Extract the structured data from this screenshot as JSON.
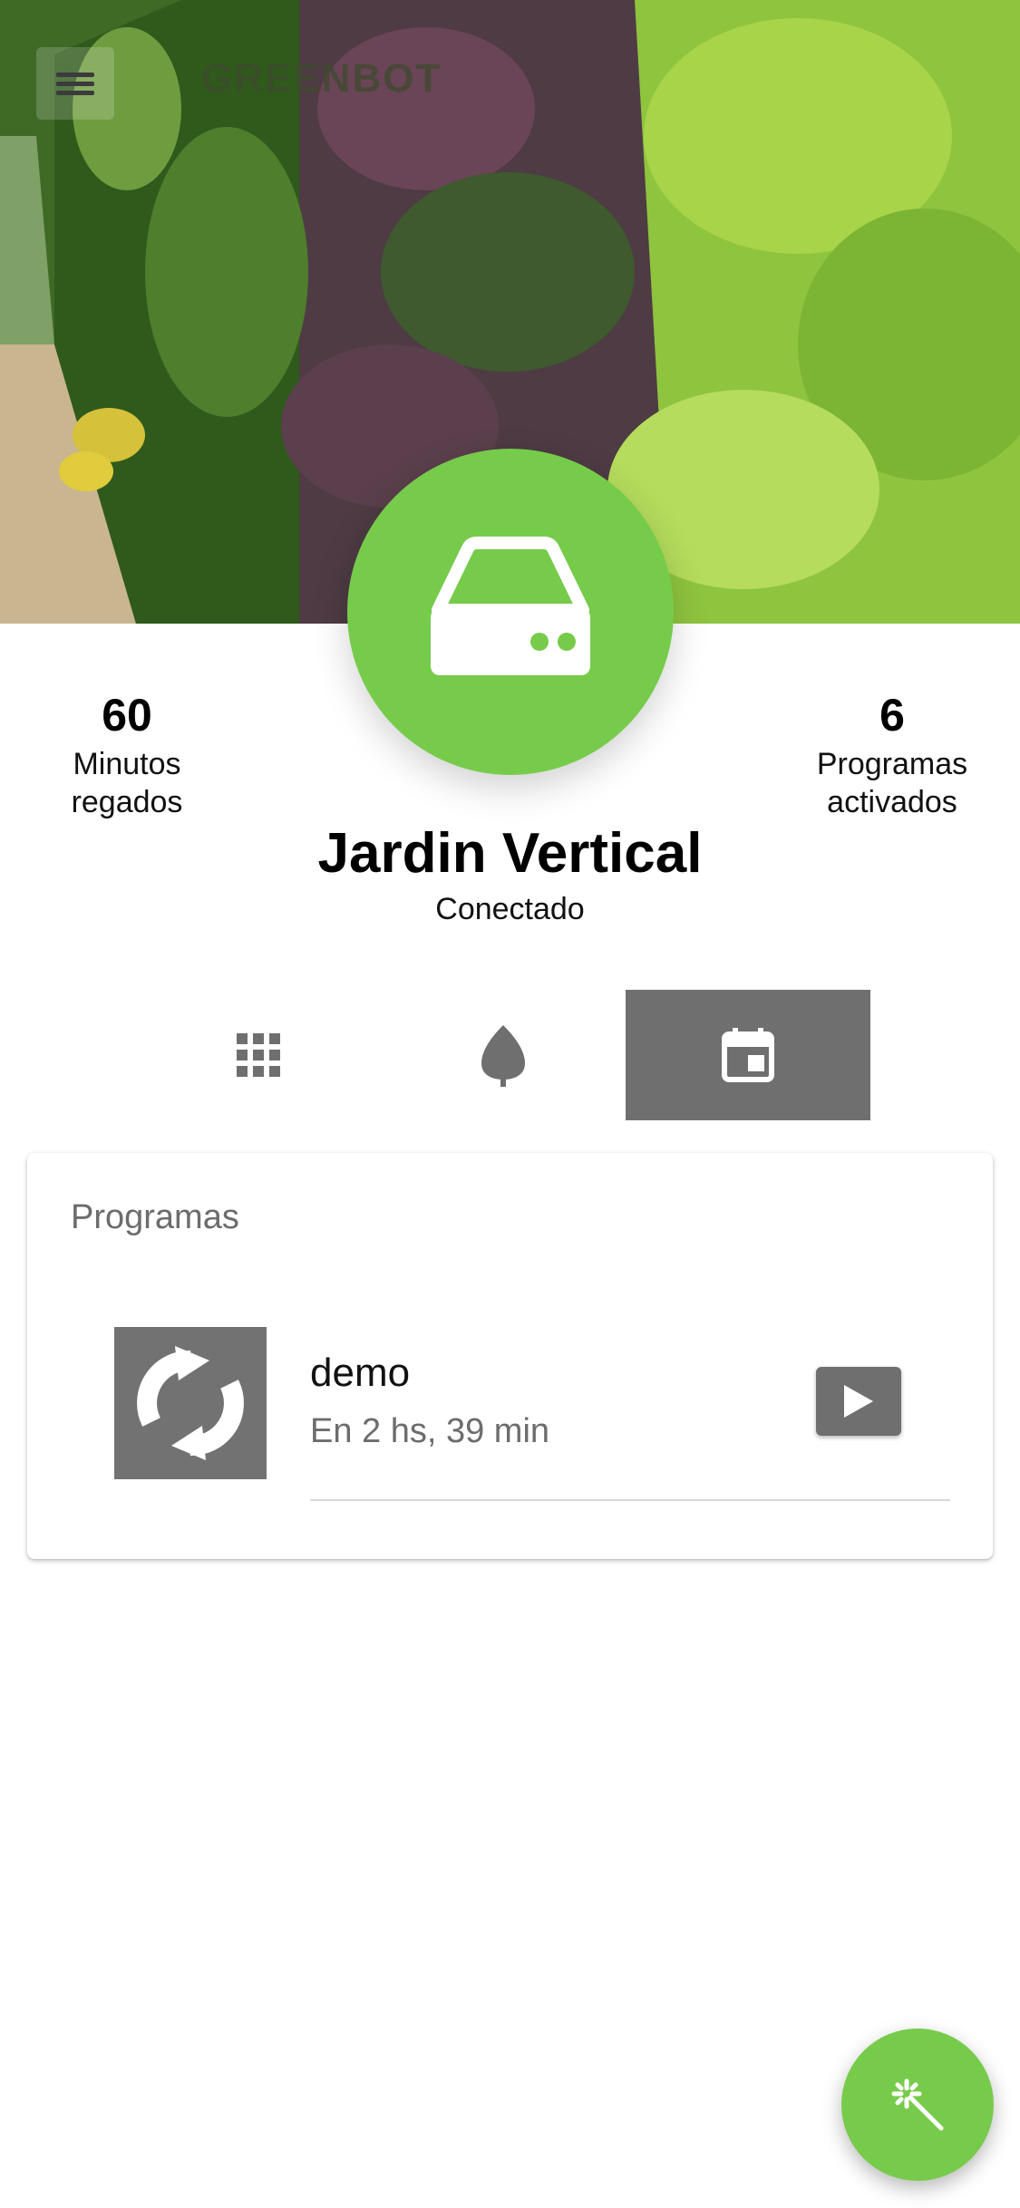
{
  "app": {
    "title": "GREENBOT",
    "menu_icon": "menu-icon"
  },
  "hero": {
    "image": "vertical-garden-photo"
  },
  "device": {
    "name": "Jardin Vertical",
    "status": "Conectado",
    "icon": "router-device-icon"
  },
  "stats": {
    "left": {
      "value": "60",
      "label_line1": "Minutos",
      "label_line2": "regados"
    },
    "right": {
      "value": "6",
      "label_line1": "Programas",
      "label_line2": "activados"
    }
  },
  "tabs": [
    {
      "icon": "grid-icon",
      "active": false
    },
    {
      "icon": "leaf-icon",
      "active": false
    },
    {
      "icon": "calendar-icon",
      "active": true
    }
  ],
  "programs": {
    "title": "Programas",
    "items": [
      {
        "name": "demo",
        "next_run": "En 2 hs, 39 min",
        "icon": "sync-icon",
        "action_icon": "play-icon"
      }
    ]
  },
  "fab": {
    "icon": "magic-wand-icon"
  },
  "colors": {
    "accent_green": "#77cb4b",
    "tab_active": "#6f6f6f",
    "secondary_text": "#6c6c6c"
  }
}
